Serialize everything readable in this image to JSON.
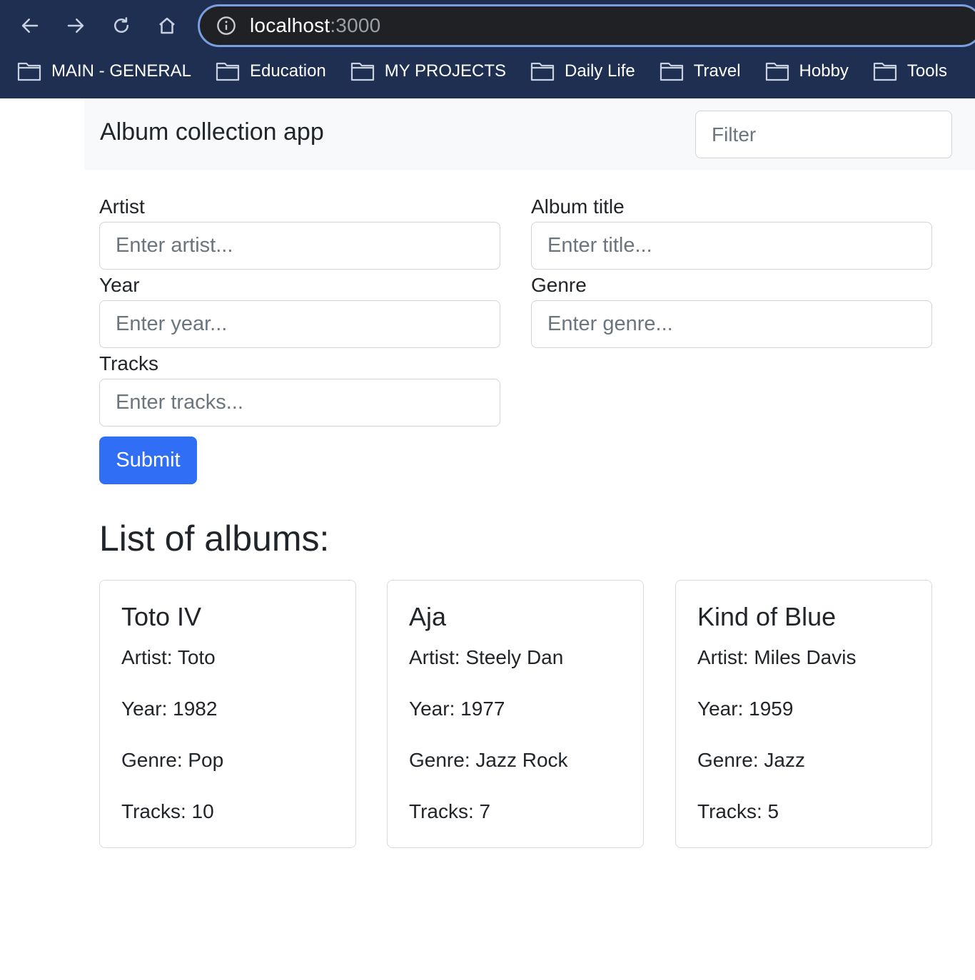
{
  "browser": {
    "url_host": "localhost",
    "url_port": ":3000",
    "bookmarks": [
      {
        "label": "MAIN - GENERAL"
      },
      {
        "label": "Education"
      },
      {
        "label": "MY PROJECTS"
      },
      {
        "label": "Daily Life"
      },
      {
        "label": "Travel"
      },
      {
        "label": "Hobby"
      },
      {
        "label": "Tools"
      }
    ]
  },
  "navbar": {
    "brand": "Album collection app",
    "filter_placeholder": "Filter"
  },
  "form": {
    "artist_label": "Artist",
    "artist_placeholder": "Enter artist...",
    "title_label": "Album title",
    "title_placeholder": "Enter title...",
    "year_label": "Year",
    "year_placeholder": "Enter year...",
    "genre_label": "Genre",
    "genre_placeholder": "Enter genre...",
    "tracks_label": "Tracks",
    "tracks_placeholder": "Enter tracks...",
    "submit_label": "Submit"
  },
  "albums_heading": "List of albums:",
  "albums": [
    {
      "title": "Toto IV",
      "artist": "Artist: Toto",
      "year": "Year: 1982",
      "genre": "Genre: Pop",
      "tracks": "Tracks: 10"
    },
    {
      "title": "Aja",
      "artist": "Artist: Steely Dan",
      "year": "Year: 1977",
      "genre": "Genre: Jazz Rock",
      "tracks": "Tracks: 7"
    },
    {
      "title": "Kind of Blue",
      "artist": "Artist: Miles Davis",
      "year": "Year: 1959",
      "genre": "Genre: Jazz",
      "tracks": "Tracks: 5"
    }
  ],
  "colors": {
    "chrome_bg": "#1e2f52",
    "omnibox_border": "#7b9ee0",
    "submit_bg": "#2f6ef5",
    "navbar_bg": "#f8f9fa"
  }
}
